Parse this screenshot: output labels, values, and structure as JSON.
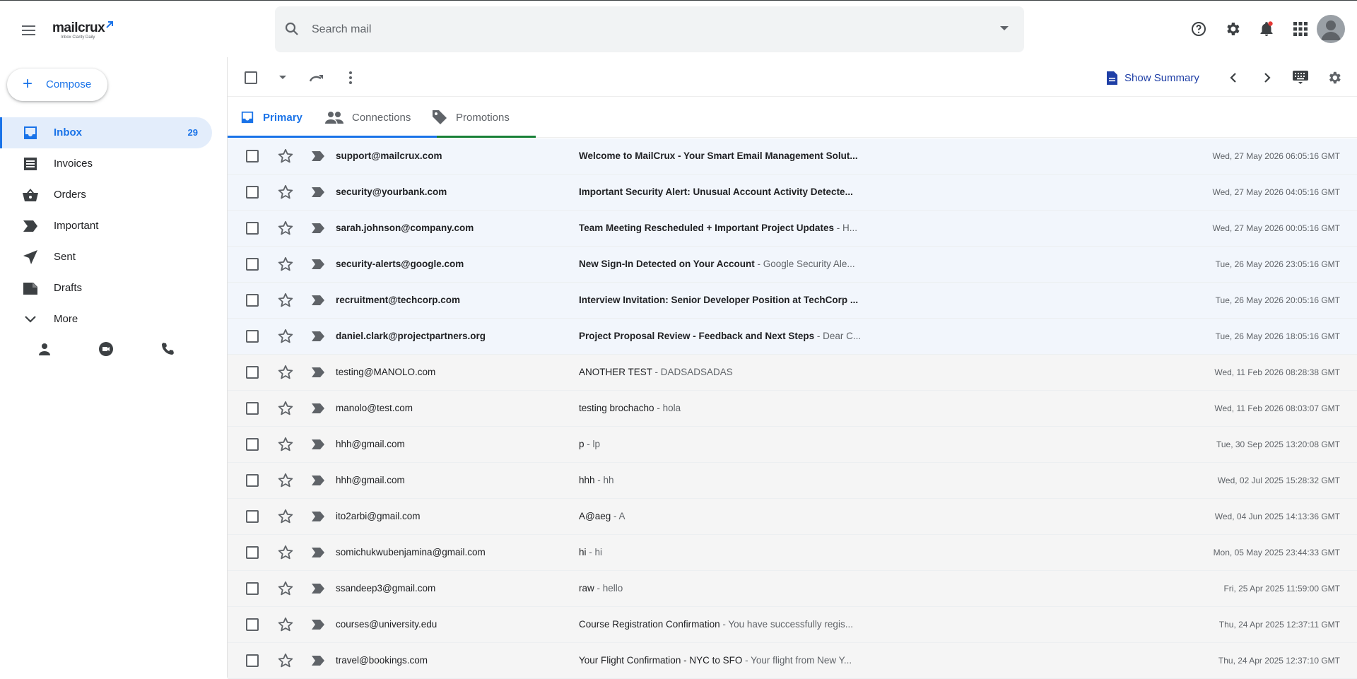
{
  "app": {
    "logo_text": "mailcrux",
    "logo_tagline": "Inbox Clarity Daily"
  },
  "search": {
    "placeholder": "Search mail"
  },
  "header_icons": [
    "help-icon",
    "gear-icon",
    "bell-icon",
    "apps-icon",
    "account-icon"
  ],
  "compose": {
    "label": "Compose"
  },
  "sidebar": {
    "items": [
      {
        "label": "Inbox",
        "icon": "inbox-icon",
        "count": "29",
        "active": true
      },
      {
        "label": "Invoices",
        "icon": "invoice-icon",
        "count": ""
      },
      {
        "label": "Orders",
        "icon": "basket-icon",
        "count": ""
      },
      {
        "label": "Important",
        "icon": "important-icon",
        "count": ""
      },
      {
        "label": "Sent",
        "icon": "send-icon",
        "count": ""
      },
      {
        "label": "Drafts",
        "icon": "draft-icon",
        "count": ""
      },
      {
        "label": "More",
        "icon": "chevron-down-icon",
        "count": ""
      }
    ],
    "quick_icons": [
      "contacts-icon",
      "meet-icon",
      "phone-icon"
    ]
  },
  "toolbar": {
    "summary_label": "Show Summary"
  },
  "tabs": [
    {
      "label": "Primary",
      "icon": "inbox-icon",
      "color": "#1a73e8",
      "active": true
    },
    {
      "label": "Connections",
      "icon": "people-icon",
      "color": "#1a73e8",
      "active": false
    },
    {
      "label": "Promotions",
      "icon": "tag-icon",
      "color": "#188038",
      "active": false
    }
  ],
  "emails": [
    {
      "sender": "support@mailcrux.com",
      "subject": "Welcome to MailCrux - Your Smart Email Management Solut...",
      "snippet": "",
      "date": "Wed, 27 May 2026 06:05:16 GMT",
      "unread": true
    },
    {
      "sender": "security@yourbank.com",
      "subject": "Important Security Alert: Unusual Account Activity Detecte...",
      "snippet": "",
      "date": "Wed, 27 May 2026 04:05:16 GMT",
      "unread": true
    },
    {
      "sender": "sarah.johnson@company.com",
      "subject": "Team Meeting Rescheduled + Important Project Updates",
      "snippet": " - H...",
      "date": "Wed, 27 May 2026 00:05:16 GMT",
      "unread": true
    },
    {
      "sender": "security-alerts@google.com",
      "subject": "New Sign-In Detected on Your Account",
      "snippet": " - Google Security Ale...",
      "date": "Tue, 26 May 2026 23:05:16 GMT",
      "unread": true
    },
    {
      "sender": "recruitment@techcorp.com",
      "subject": "Interview Invitation: Senior Developer Position at TechCorp ...",
      "snippet": "",
      "date": "Tue, 26 May 2026 20:05:16 GMT",
      "unread": true
    },
    {
      "sender": "daniel.clark@projectpartners.org",
      "subject": "Project Proposal Review - Feedback and Next Steps",
      "snippet": " - Dear C...",
      "date": "Tue, 26 May 2026 18:05:16 GMT",
      "unread": true
    },
    {
      "sender": "testing@MANOLO.com",
      "subject": "ANOTHER TEST",
      "snippet": " - DADSADSADAS",
      "date": "Wed, 11 Feb 2026 08:28:38 GMT",
      "unread": false
    },
    {
      "sender": "manolo@test.com",
      "subject": "testing brochacho",
      "snippet": " - hola",
      "date": "Wed, 11 Feb 2026 08:03:07 GMT",
      "unread": false
    },
    {
      "sender": "hhh@gmail.com",
      "subject": "p",
      "snippet": " - lp",
      "date": "Tue, 30 Sep 2025 13:20:08 GMT",
      "unread": false
    },
    {
      "sender": "hhh@gmail.com",
      "subject": "hhh",
      "snippet": " - hh",
      "date": "Wed, 02 Jul 2025 15:28:32 GMT",
      "unread": false
    },
    {
      "sender": "ito2arbi@gmail.com",
      "subject": "A@aeg",
      "snippet": " - A",
      "date": "Wed, 04 Jun 2025 14:13:36 GMT",
      "unread": false
    },
    {
      "sender": "somichukwubenjamina@gmail.com",
      "subject": "hi",
      "snippet": " - hi",
      "date": "Mon, 05 May 2025 23:44:33 GMT",
      "unread": false
    },
    {
      "sender": "ssandeep3@gmail.com",
      "subject": " raw",
      "snippet": " - hello",
      "date": "Fri, 25 Apr 2025 11:59:00 GMT",
      "unread": false
    },
    {
      "sender": "courses@university.edu",
      "subject": "Course Registration Confirmation",
      "snippet": " - You have successfully regis...",
      "date": "Thu, 24 Apr 2025 12:37:11 GMT",
      "unread": false
    },
    {
      "sender": "travel@bookings.com",
      "subject": "Your Flight Confirmation - NYC to SFO",
      "snippet": " - Your flight from New Y...",
      "date": "Thu, 24 Apr 2025 12:37:10 GMT",
      "unread": false
    }
  ]
}
